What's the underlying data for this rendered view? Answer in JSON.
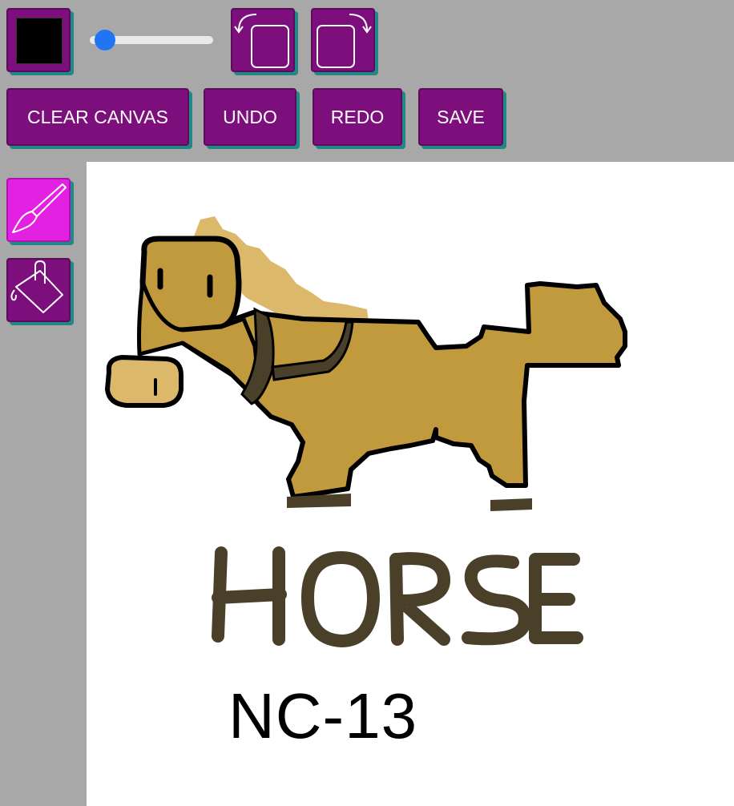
{
  "toolbar": {
    "brush_color": "#000000",
    "brush_size": 0.05,
    "clear_label": "CLEAR CANVAS",
    "undo_label": "UNDO",
    "redo_label": "REDO",
    "save_label": "SAVE",
    "rotate_left_icon": "rotate-left-icon",
    "rotate_right_icon": "rotate-right-icon"
  },
  "tools": {
    "brush_icon": "brush-icon",
    "fill_icon": "paint-bucket-icon",
    "active": "brush"
  },
  "canvas": {
    "drawing_title": "HORSE",
    "drawing_code": "NC-13",
    "colors": {
      "accent_button": "#7d0f7d",
      "active_tool": "#e321e3",
      "button_shadow": "#238787",
      "body_fill": "#c29a3e",
      "mane_fill": "#dcb86a",
      "outline": "#000000",
      "lettering": "#4a3f28"
    }
  }
}
